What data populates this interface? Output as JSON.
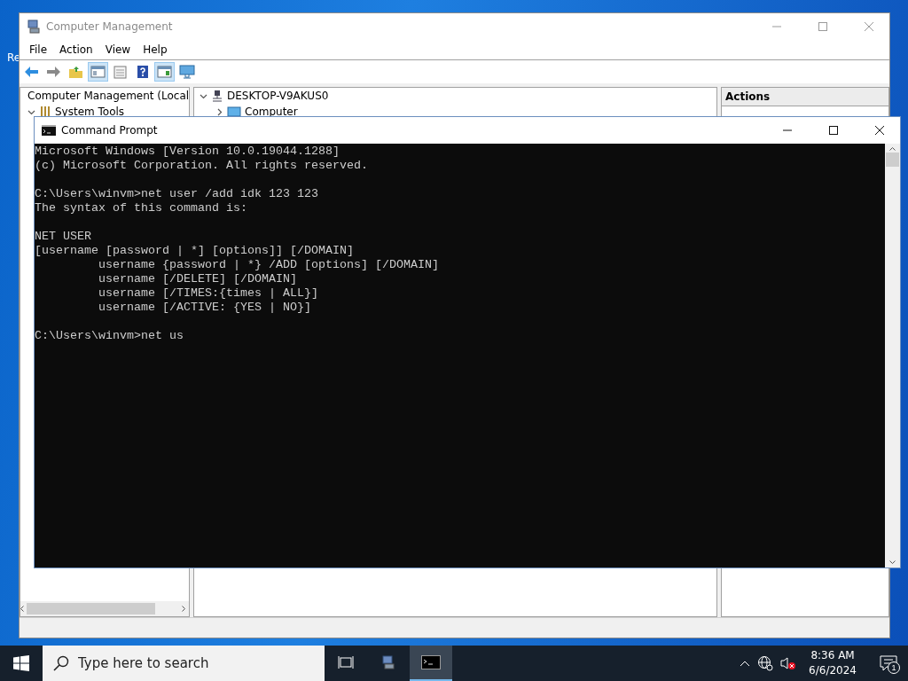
{
  "desktop": {
    "icon_label": "Re"
  },
  "computer_management": {
    "title": "Computer Management",
    "menu": [
      "File",
      "Action",
      "View",
      "Help"
    ],
    "toolbar": [
      {
        "kind": "back",
        "pressed": false
      },
      {
        "kind": "forward",
        "pressed": false
      },
      {
        "kind": "up",
        "pressed": false
      },
      {
        "kind": "tree",
        "pressed": true
      },
      {
        "kind": "properties",
        "pressed": false
      },
      {
        "kind": "help",
        "pressed": false
      },
      {
        "kind": "pane",
        "pressed": true
      },
      {
        "kind": "monitor",
        "pressed": false
      }
    ],
    "tree": {
      "label": "Computer Management (Local",
      "children": [
        {
          "label": "System Tools",
          "expanded": true
        }
      ]
    },
    "device_tree": {
      "label": "DESKTOP-V9AKUS0",
      "expanded": true,
      "children": [
        {
          "label": "Computer",
          "expanded": false
        }
      ]
    },
    "actions": {
      "title": "Actions"
    }
  },
  "command_prompt": {
    "title": "Command Prompt",
    "blocks": [
      [
        "Microsoft Windows [Version 10.0.19044.1288]",
        "(c) Microsoft Corporation. All rights reserved."
      ],
      [
        "C:\\Users\\winvm>net user /add idk 123 123",
        "The syntax of this command is:"
      ],
      [
        "NET USER",
        "[username [password | *] [options]] [/DOMAIN]",
        "         username {password | *} /ADD [options] [/DOMAIN]",
        "         username [/DELETE] [/DOMAIN]",
        "         username [/TIMES:{times | ALL}]",
        "         username [/ACTIVE: {YES | NO}]"
      ],
      [
        "C:\\Users\\winvm>net us"
      ]
    ]
  },
  "taskbar": {
    "search": {
      "placeholder": "Type here to search"
    },
    "apps": [
      {
        "kind": "management",
        "selected": false
      },
      {
        "kind": "terminal",
        "selected": true
      }
    ],
    "time": "8:36 AM",
    "date": "6/6/2024",
    "notifications": "1"
  }
}
